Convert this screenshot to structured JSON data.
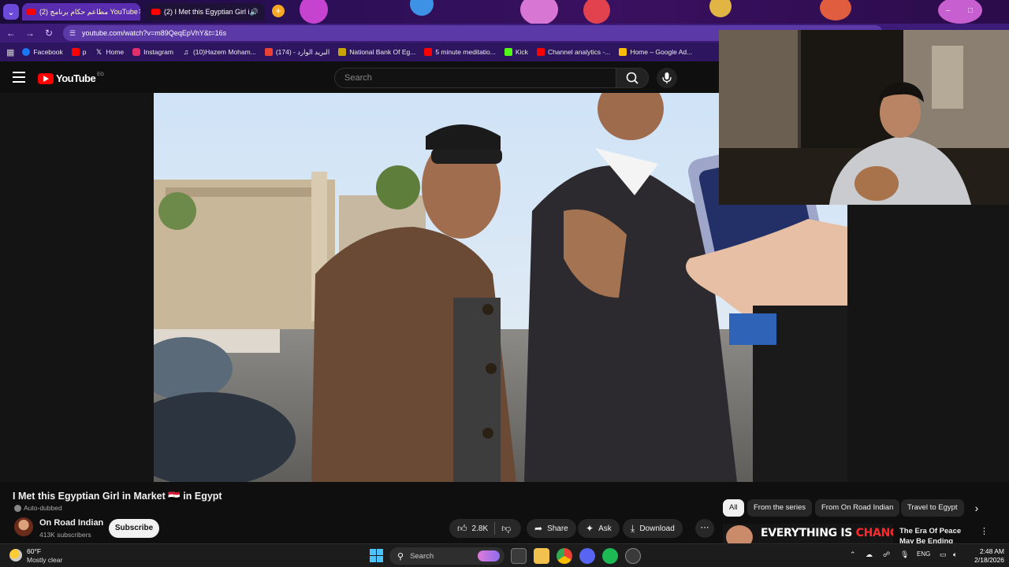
{
  "browser": {
    "tabs": [
      {
        "title": "مطاعم حكام برنامج (2) YouTube"
      },
      {
        "title": "(2) I Met this Egyptian Girl i"
      }
    ],
    "address_url": "youtube.com/watch?v=m89QeqEpVhY&t=16s",
    "bookmarks": [
      {
        "label": "Facebook",
        "color": "#1877f2"
      },
      {
        "label": "p",
        "color": "#ff0000"
      },
      {
        "label": "Home",
        "color": "#ffffff"
      },
      {
        "label": "Instagram",
        "color": "#e1306c"
      },
      {
        "label": "(10)Hazem Moham...",
        "color": "#ffffff"
      },
      {
        "label": "(174) - البريد الوارد",
        "color": "#ea4335"
      },
      {
        "label": "National Bank Of Eg...",
        "color": "#c8a400"
      },
      {
        "label": "5 minute meditatio...",
        "color": "#ff0000"
      },
      {
        "label": "Kick",
        "color": "#53fc18"
      },
      {
        "label": "Channel analytics -...",
        "color": "#ff0000"
      },
      {
        "label": "Home – Google Ad...",
        "color": "#fbbc04"
      }
    ]
  },
  "youtube": {
    "logo_text": "YouTube",
    "country_code": "EG",
    "search_placeholder": "Search"
  },
  "video": {
    "title": "I Met this Egyptian Girl in Market 🇪🇬 in Egypt",
    "auto_dubbed": "Auto-dubbed",
    "channel_name": "On Road Indian",
    "subscribers": "413K subscribers",
    "subscribe_label": "Subscribe",
    "likes": "2.8K",
    "share_label": "Share",
    "ask_label": "Ask",
    "download_label": "Download"
  },
  "chips": [
    "All",
    "From the series",
    "From On Road Indian",
    "Travel to Egypt"
  ],
  "recommendation": {
    "thumb_text_white": "EVERYTHING IS ",
    "thumb_text_red": "CHANGING",
    "title": "The Era Of Peace May Be Ending"
  },
  "taskbar": {
    "temperature": "60°F",
    "condition": "Mostly clear",
    "search_label": "Search",
    "language": "ENG",
    "time": "2:48 AM",
    "date": "2/18/2026"
  },
  "colors": {
    "accent": "#4cc2ff",
    "youtube_red": "#ff0000",
    "tab_strip": "#2a0f55"
  }
}
